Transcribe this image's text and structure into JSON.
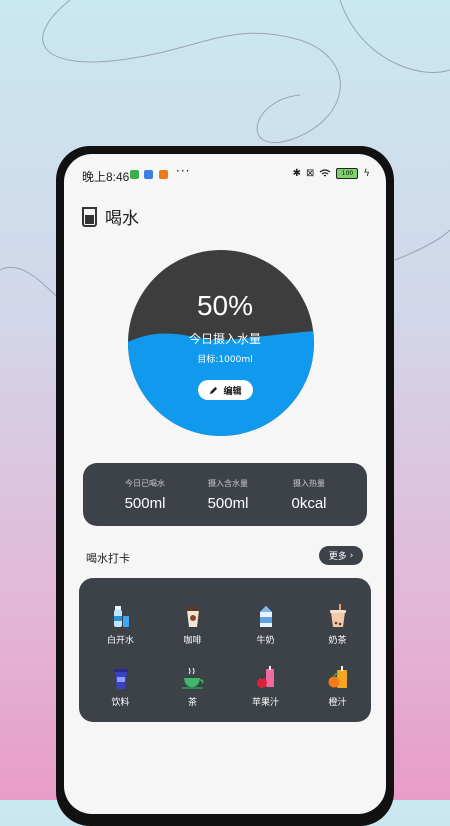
{
  "status_bar": {
    "time": "晚上8:46",
    "dots": "···",
    "battery": "100"
  },
  "header": {
    "title": "喝水"
  },
  "gauge": {
    "percent": "50%",
    "label": "今日摄入水量",
    "goal": "目标:1000ml",
    "edit_label": "编辑",
    "fill_fraction": 0.5,
    "colors": {
      "dark": "#3d3d3d",
      "water": "#1199ee"
    }
  },
  "stats": [
    {
      "label": "今日已喝水",
      "value": "500ml"
    },
    {
      "label": "摄入含水量",
      "value": "500ml"
    },
    {
      "label": "摄入热量",
      "value": "0kcal"
    }
  ],
  "checkin": {
    "title": "喝水打卡",
    "more_label": "更多",
    "drinks": [
      {
        "name": "白开水",
        "icon": "water-bottle-icon"
      },
      {
        "name": "咖啡",
        "icon": "coffee-cup-icon"
      },
      {
        "name": "牛奶",
        "icon": "milk-carton-icon"
      },
      {
        "name": "奶茶",
        "icon": "milk-tea-icon"
      },
      {
        "name": "饮料",
        "icon": "soda-cup-icon"
      },
      {
        "name": "茶",
        "icon": "tea-cup-icon"
      },
      {
        "name": "苹果汁",
        "icon": "apple-juice-icon"
      },
      {
        "name": "橙汁",
        "icon": "orange-juice-icon"
      }
    ]
  }
}
